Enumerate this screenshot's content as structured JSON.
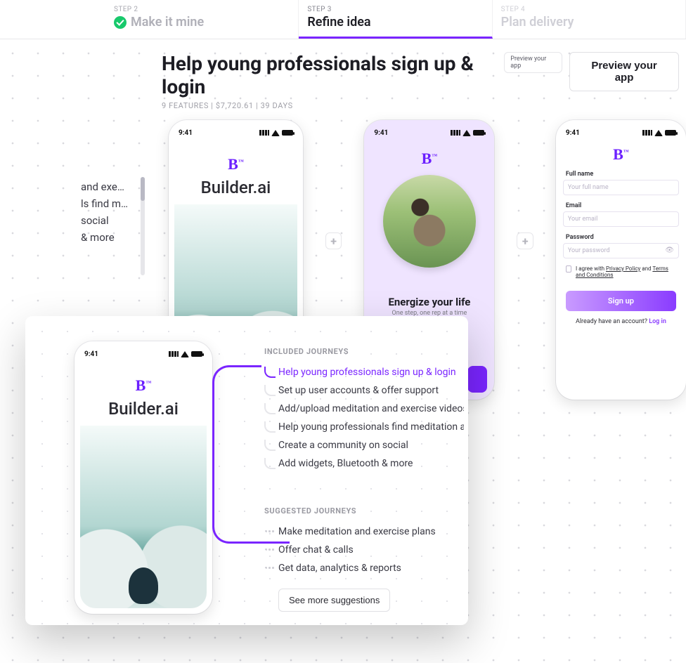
{
  "stepper": {
    "step2": {
      "eyebrow": "STEP 2",
      "title": "Make it mine"
    },
    "step3": {
      "eyebrow": "STEP 3",
      "title": "Refine idea"
    },
    "step4": {
      "eyebrow": "STEP 4",
      "title": "Plan delivery"
    }
  },
  "header": {
    "title": "Help young professionals sign up & login",
    "meta": "9 FEATURES | $7,720.61 | 39 DAYS",
    "preview_pill": "Preview your app",
    "preview_btn": "Preview your app"
  },
  "peek": {
    "l1": "and exe…",
    "l2": "ls find m…",
    "l3": "social",
    "l4": "& more"
  },
  "phones": {
    "time": "9:41",
    "brand": "Builder.ai",
    "energize_title": "Energize your life",
    "energize_sub": "One step, one rep at a time",
    "form": {
      "fullname_label": "Full name",
      "fullname_ph": "Your full name",
      "email_label": "Email",
      "email_ph": "Your email",
      "password_label": "Password",
      "password_ph": "Your password",
      "agree_pre": "I agree with ",
      "agree_pp": "Privacy Policy",
      "agree_mid": " and ",
      "agree_tc": "Terms and Conditions",
      "signup": "Sign up",
      "already": "Already have an account? ",
      "login": "Log in"
    }
  },
  "card": {
    "included_head": "INCLUDED JOURNEYS",
    "inc1": "Help young professionals sign up & login",
    "inc2": "Set up user accounts & offer support",
    "inc3": "Add/upload meditation and exercise videos, ph…",
    "inc4": "Help young professionals find meditation and e…",
    "inc5": "Create a community on social",
    "inc6": "Add widgets, Bluetooth & more",
    "suggested_head": "SUGGESTED JOURNEYS",
    "s1": "Make meditation and exercise plans",
    "s2": "Offer chat & calls",
    "s3": "Get data, analytics & reports",
    "seemore": "See more suggestions"
  }
}
